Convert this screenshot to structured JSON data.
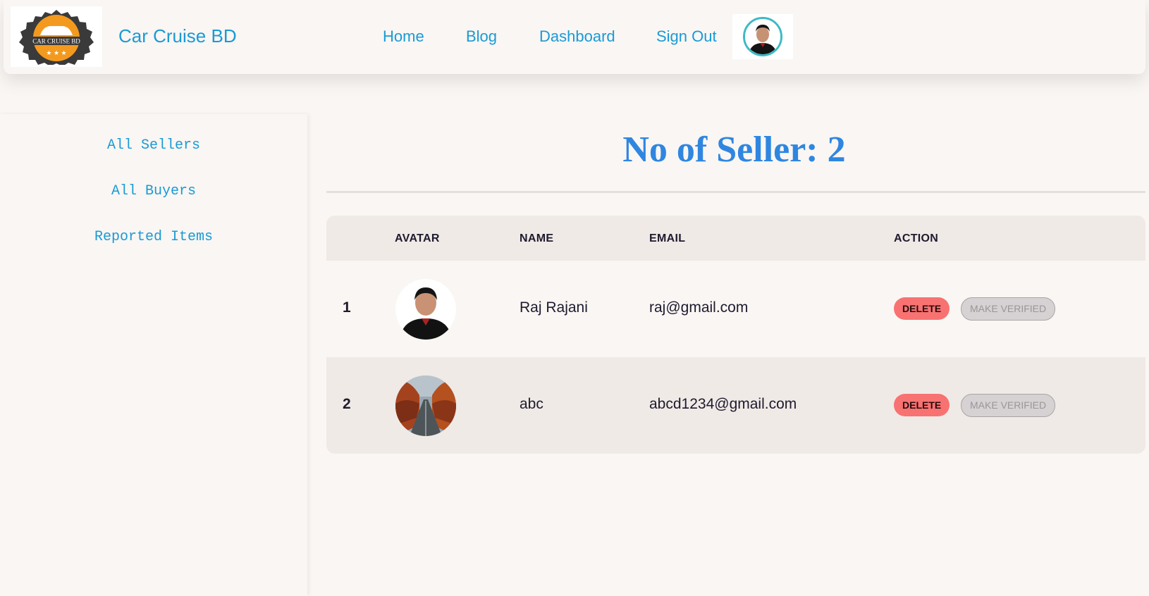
{
  "navbar": {
    "logo_text": "CAR CRUISE BD",
    "brand": "Car Cruise BD",
    "links": {
      "home": "Home",
      "blog": "Blog",
      "dashboard": "Dashboard",
      "sign_out": "Sign Out"
    }
  },
  "sidebar": {
    "items": [
      "All Sellers",
      "All Buyers",
      "Reported Items"
    ]
  },
  "main": {
    "title": "No of Seller: 2",
    "table": {
      "headers": {
        "avatar": "AVATAR",
        "name": "NAME",
        "email": "EMAIL",
        "action": "ACTION"
      },
      "rows": [
        {
          "index": "1",
          "name": "Raj Rajani",
          "email": "raj@gmail.com",
          "avatar_icon": "person-photo",
          "delete_label": "DELETE",
          "verify_label": "MAKE VERIFIED"
        },
        {
          "index": "2",
          "name": "abc",
          "email": "abcd1234@gmail.com",
          "avatar_icon": "autumn-road-photo",
          "delete_label": "DELETE",
          "verify_label": "MAKE VERIFIED"
        }
      ]
    }
  },
  "colors": {
    "accent_link": "#1a9ad6",
    "title": "#2f86e0",
    "delete": "#f87272",
    "verify_disabled": "#d6d1d2",
    "avatar_ring": "#3cbac4"
  }
}
